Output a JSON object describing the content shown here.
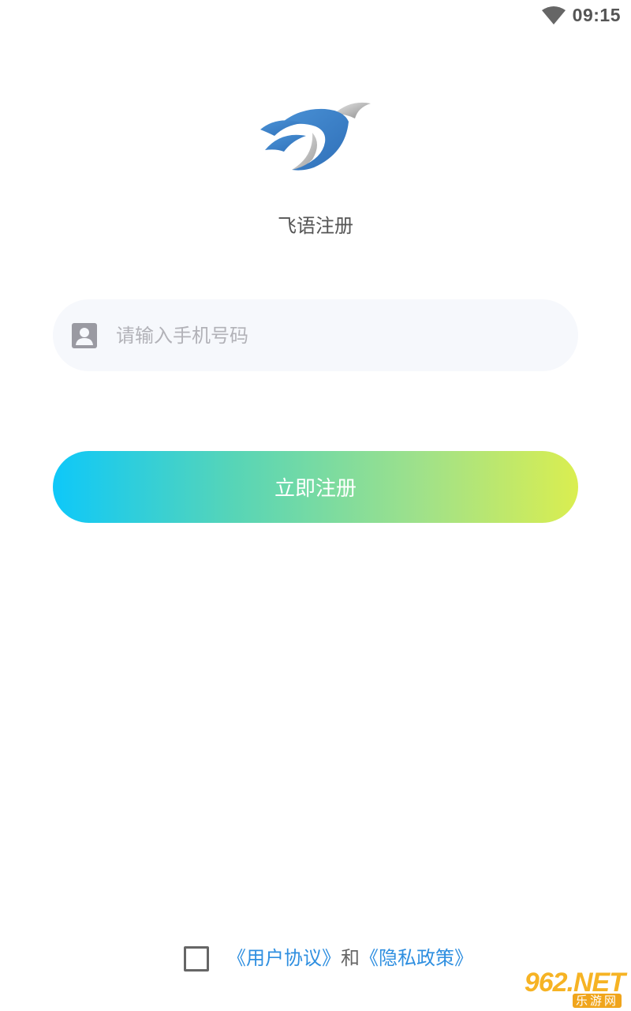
{
  "status_bar": {
    "time": "09:15",
    "wifi_icon": "wifi-icon"
  },
  "logo": {
    "icon": "bird-logo-icon",
    "colors": {
      "blue": "#3a7fc4",
      "silver": "#bfbfbf"
    }
  },
  "page": {
    "title": "飞语注册"
  },
  "form": {
    "phone": {
      "icon": "person-icon",
      "value": "",
      "placeholder": "请输入手机号码"
    },
    "submit_label": "立即注册",
    "button_gradient": [
      "#0ec8f9",
      "#58d5b6",
      "#9fe18a",
      "#daee50"
    ]
  },
  "agreement": {
    "checked": false,
    "user_agreement_link": "《用户协议》",
    "conjunction": "和",
    "privacy_policy_link": "《隐私政策》",
    "link_color": "#2f8fe0"
  },
  "watermark": {
    "main": "962.NET",
    "sub": "乐游网"
  }
}
